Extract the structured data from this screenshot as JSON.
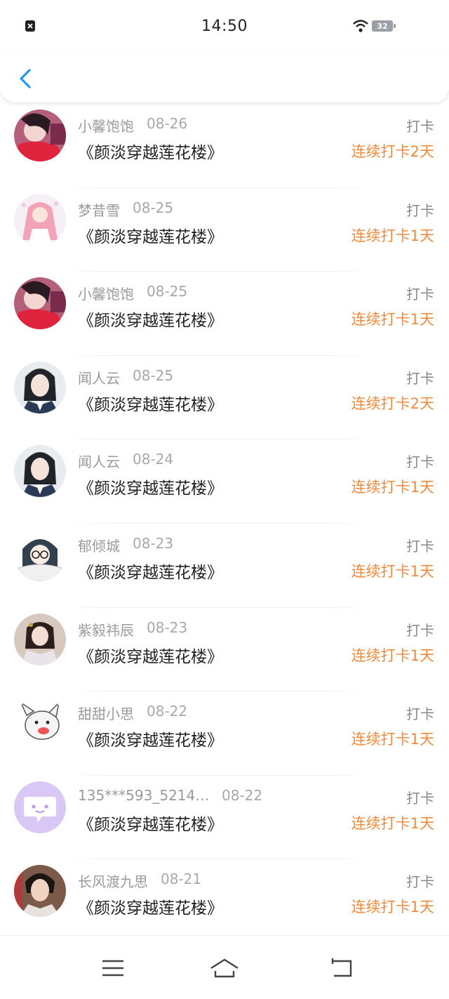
{
  "status_bar": {
    "time": "14:50",
    "battery": "32"
  },
  "entries": [
    {
      "name": "小馨饱饱",
      "date": "08-26",
      "book": "《颜淡穿越莲花楼》",
      "action": "打卡",
      "streak": "连续打卡2天",
      "avatar": "girl-red-scarf"
    },
    {
      "name": "梦昔雪",
      "date": "08-25",
      "book": "《颜淡穿越莲花楼》",
      "action": "打卡",
      "streak": "连续打卡1天",
      "avatar": "anime-pink-hair"
    },
    {
      "name": "小馨饱饱",
      "date": "08-25",
      "book": "《颜淡穿越莲花楼》",
      "action": "打卡",
      "streak": "连续打卡1天",
      "avatar": "girl-red-scarf"
    },
    {
      "name": "闻人云",
      "date": "08-25",
      "book": "《颜淡穿越莲花楼》",
      "action": "打卡",
      "streak": "连续打卡2天",
      "avatar": "ancient-man"
    },
    {
      "name": "闻人云",
      "date": "08-24",
      "book": "《颜淡穿越莲花楼》",
      "action": "打卡",
      "streak": "连续打卡1天",
      "avatar": "ancient-man"
    },
    {
      "name": "郁倾城",
      "date": "08-23",
      "book": "《颜淡穿越莲花楼》",
      "action": "打卡",
      "streak": "连续打卡1天",
      "avatar": "cartoon-glasses"
    },
    {
      "name": "紫毅祎辰",
      "date": "08-23",
      "book": "《颜淡穿越莲花楼》",
      "action": "打卡",
      "streak": "连续打卡1天",
      "avatar": "ancient-woman"
    },
    {
      "name": "甜甜小思",
      "date": "08-22",
      "book": "《颜淡穿越莲花楼》",
      "action": "打卡",
      "streak": "连续打卡1天",
      "avatar": "cartoon-dog"
    },
    {
      "name": "135***593_5214…",
      "date": "08-22",
      "book": "《颜淡穿越莲花楼》",
      "action": "打卡",
      "streak": "连续打卡1天",
      "avatar": "default-chat"
    },
    {
      "name": "长风渡九思",
      "date": "08-21",
      "book": "《颜淡穿越莲花楼》",
      "action": "打卡",
      "streak": "连续打卡1天",
      "avatar": "young-man"
    }
  ],
  "colors": {
    "accent": "#2196f3",
    "streak": "#f08a3c",
    "default_avatar": "#d9c8f5"
  }
}
